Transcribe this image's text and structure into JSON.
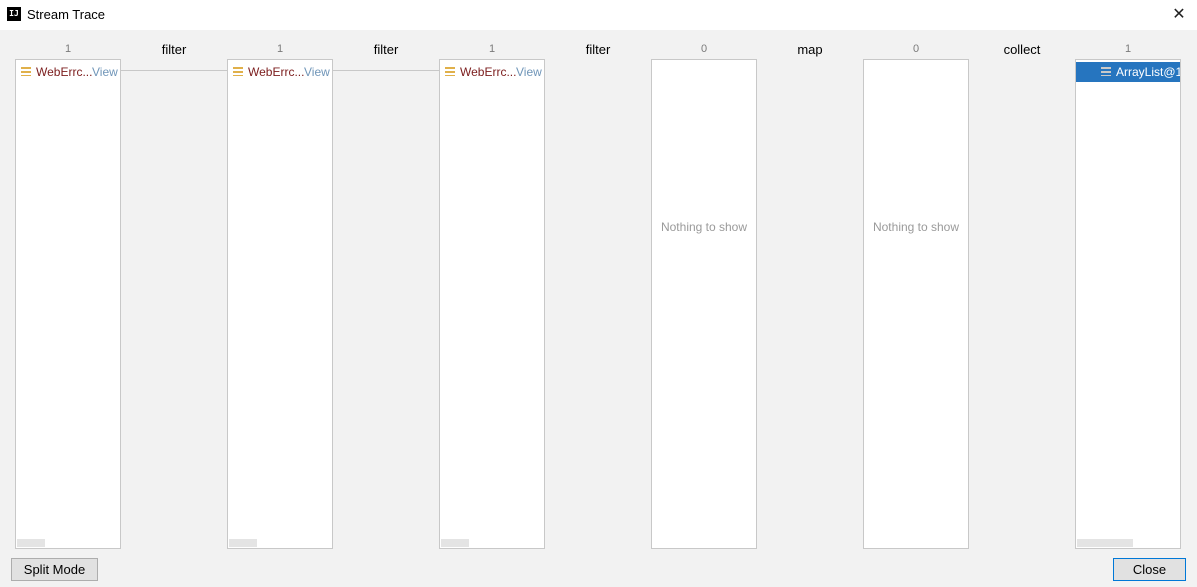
{
  "window": {
    "title": "Stream Trace",
    "app_icon_text": "IJ",
    "close_glyph": "✕"
  },
  "operations": [
    "filter",
    "filter",
    "filter",
    "map",
    "collect"
  ],
  "columns": [
    {
      "count": "1",
      "item": "WebErrc...",
      "view": "View"
    },
    {
      "count": "1",
      "item": "WebErrc...",
      "view": "View"
    },
    {
      "count": "1",
      "item": "WebErrc...",
      "view": "View"
    },
    {
      "count": "0",
      "empty": "Nothing to show"
    },
    {
      "count": "0",
      "empty": "Nothing to show"
    },
    {
      "count": "1",
      "item": "ArrayList@1"
    }
  ],
  "buttons": {
    "split_mode": "Split Mode",
    "close": "Close"
  },
  "colors": {
    "selection": "#2675bf",
    "item_text": "#7b1c1c",
    "view_link": "#6f95b8",
    "item_icon": "#e0b04a"
  },
  "icons": {
    "app": "intellij-icon",
    "item": "list-icon",
    "close": "close-icon"
  }
}
